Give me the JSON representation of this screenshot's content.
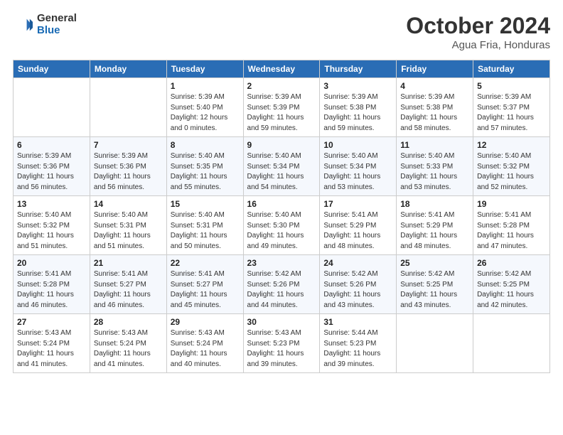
{
  "header": {
    "logo_general": "General",
    "logo_blue": "Blue",
    "month_title": "October 2024",
    "location": "Agua Fria, Honduras"
  },
  "days_of_week": [
    "Sunday",
    "Monday",
    "Tuesday",
    "Wednesday",
    "Thursday",
    "Friday",
    "Saturday"
  ],
  "weeks": [
    [
      {
        "day": "",
        "info": ""
      },
      {
        "day": "",
        "info": ""
      },
      {
        "day": "1",
        "info": "Sunrise: 5:39 AM\nSunset: 5:40 PM\nDaylight: 12 hours\nand 0 minutes."
      },
      {
        "day": "2",
        "info": "Sunrise: 5:39 AM\nSunset: 5:39 PM\nDaylight: 11 hours\nand 59 minutes."
      },
      {
        "day": "3",
        "info": "Sunrise: 5:39 AM\nSunset: 5:38 PM\nDaylight: 11 hours\nand 59 minutes."
      },
      {
        "day": "4",
        "info": "Sunrise: 5:39 AM\nSunset: 5:38 PM\nDaylight: 11 hours\nand 58 minutes."
      },
      {
        "day": "5",
        "info": "Sunrise: 5:39 AM\nSunset: 5:37 PM\nDaylight: 11 hours\nand 57 minutes."
      }
    ],
    [
      {
        "day": "6",
        "info": "Sunrise: 5:39 AM\nSunset: 5:36 PM\nDaylight: 11 hours\nand 56 minutes."
      },
      {
        "day": "7",
        "info": "Sunrise: 5:39 AM\nSunset: 5:36 PM\nDaylight: 11 hours\nand 56 minutes."
      },
      {
        "day": "8",
        "info": "Sunrise: 5:40 AM\nSunset: 5:35 PM\nDaylight: 11 hours\nand 55 minutes."
      },
      {
        "day": "9",
        "info": "Sunrise: 5:40 AM\nSunset: 5:34 PM\nDaylight: 11 hours\nand 54 minutes."
      },
      {
        "day": "10",
        "info": "Sunrise: 5:40 AM\nSunset: 5:34 PM\nDaylight: 11 hours\nand 53 minutes."
      },
      {
        "day": "11",
        "info": "Sunrise: 5:40 AM\nSunset: 5:33 PM\nDaylight: 11 hours\nand 53 minutes."
      },
      {
        "day": "12",
        "info": "Sunrise: 5:40 AM\nSunset: 5:32 PM\nDaylight: 11 hours\nand 52 minutes."
      }
    ],
    [
      {
        "day": "13",
        "info": "Sunrise: 5:40 AM\nSunset: 5:32 PM\nDaylight: 11 hours\nand 51 minutes."
      },
      {
        "day": "14",
        "info": "Sunrise: 5:40 AM\nSunset: 5:31 PM\nDaylight: 11 hours\nand 51 minutes."
      },
      {
        "day": "15",
        "info": "Sunrise: 5:40 AM\nSunset: 5:31 PM\nDaylight: 11 hours\nand 50 minutes."
      },
      {
        "day": "16",
        "info": "Sunrise: 5:40 AM\nSunset: 5:30 PM\nDaylight: 11 hours\nand 49 minutes."
      },
      {
        "day": "17",
        "info": "Sunrise: 5:41 AM\nSunset: 5:29 PM\nDaylight: 11 hours\nand 48 minutes."
      },
      {
        "day": "18",
        "info": "Sunrise: 5:41 AM\nSunset: 5:29 PM\nDaylight: 11 hours\nand 48 minutes."
      },
      {
        "day": "19",
        "info": "Sunrise: 5:41 AM\nSunset: 5:28 PM\nDaylight: 11 hours\nand 47 minutes."
      }
    ],
    [
      {
        "day": "20",
        "info": "Sunrise: 5:41 AM\nSunset: 5:28 PM\nDaylight: 11 hours\nand 46 minutes."
      },
      {
        "day": "21",
        "info": "Sunrise: 5:41 AM\nSunset: 5:27 PM\nDaylight: 11 hours\nand 46 minutes."
      },
      {
        "day": "22",
        "info": "Sunrise: 5:41 AM\nSunset: 5:27 PM\nDaylight: 11 hours\nand 45 minutes."
      },
      {
        "day": "23",
        "info": "Sunrise: 5:42 AM\nSunset: 5:26 PM\nDaylight: 11 hours\nand 44 minutes."
      },
      {
        "day": "24",
        "info": "Sunrise: 5:42 AM\nSunset: 5:26 PM\nDaylight: 11 hours\nand 43 minutes."
      },
      {
        "day": "25",
        "info": "Sunrise: 5:42 AM\nSunset: 5:25 PM\nDaylight: 11 hours\nand 43 minutes."
      },
      {
        "day": "26",
        "info": "Sunrise: 5:42 AM\nSunset: 5:25 PM\nDaylight: 11 hours\nand 42 minutes."
      }
    ],
    [
      {
        "day": "27",
        "info": "Sunrise: 5:43 AM\nSunset: 5:24 PM\nDaylight: 11 hours\nand 41 minutes."
      },
      {
        "day": "28",
        "info": "Sunrise: 5:43 AM\nSunset: 5:24 PM\nDaylight: 11 hours\nand 41 minutes."
      },
      {
        "day": "29",
        "info": "Sunrise: 5:43 AM\nSunset: 5:24 PM\nDaylight: 11 hours\nand 40 minutes."
      },
      {
        "day": "30",
        "info": "Sunrise: 5:43 AM\nSunset: 5:23 PM\nDaylight: 11 hours\nand 39 minutes."
      },
      {
        "day": "31",
        "info": "Sunrise: 5:44 AM\nSunset: 5:23 PM\nDaylight: 11 hours\nand 39 minutes."
      },
      {
        "day": "",
        "info": ""
      },
      {
        "day": "",
        "info": ""
      }
    ]
  ]
}
